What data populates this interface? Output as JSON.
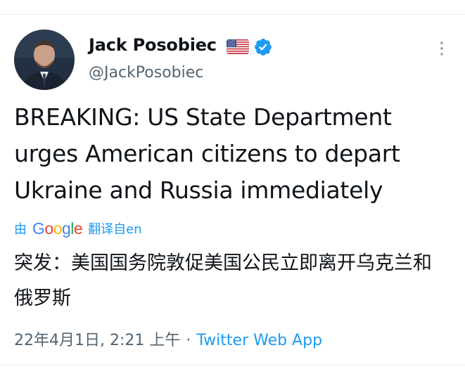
{
  "author": {
    "display_name": "Jack Posobiec",
    "handle": "@JackPosobiec"
  },
  "tweet": {
    "text": "BREAKING: US State Department urges American citizens to depart Ukraine and Russia immediately"
  },
  "translation": {
    "by_label": "由",
    "provider": "Google",
    "action_label": "翻译自en",
    "text": "突发：美国国务院敦促美国公民立即离开乌克兰和俄罗斯"
  },
  "meta": {
    "timestamp": "22年4月1日, 2:21 上午",
    "separator": "·",
    "source": "Twitter Web App"
  },
  "icons": {
    "flag": "us-flag-icon",
    "verified": "verified-badge-icon",
    "more": "more-options-icon"
  },
  "colors": {
    "link_blue": "#1d9bf0",
    "secondary_text": "#536471",
    "primary_text": "#0f1419"
  }
}
